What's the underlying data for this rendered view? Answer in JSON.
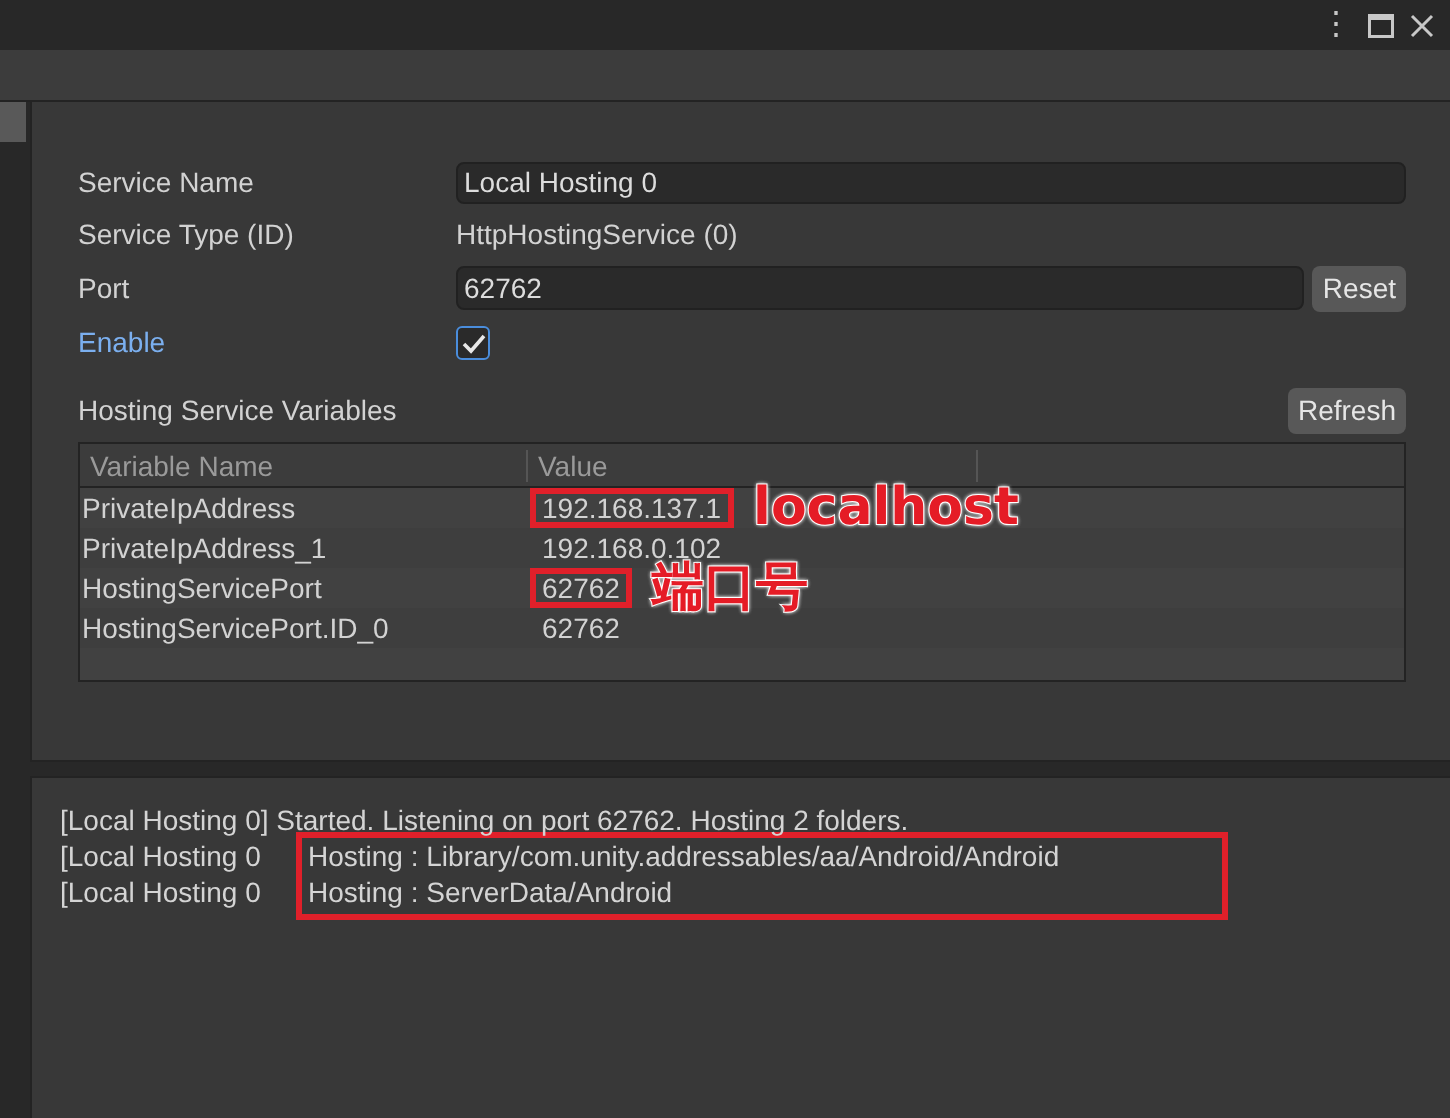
{
  "window_controls": [
    "⋮"
  ],
  "service": {
    "name_label": "Service Name",
    "name_value": "Local Hosting 0",
    "type_label": "Service Type (ID)",
    "type_value": "HttpHostingService (0)",
    "port_label": "Port",
    "port_value": "62762",
    "reset_button": "Reset",
    "enable_label": "Enable",
    "enable_checked": true
  },
  "variables": {
    "title": "Hosting Service Variables",
    "refresh_button": "Refresh",
    "columns": [
      "Variable Name",
      "Value"
    ],
    "rows": [
      {
        "name": "PrivateIpAddress",
        "value": "192.168.137.1",
        "highlighted": true,
        "annotation": "localhost"
      },
      {
        "name": "PrivateIpAddress_1",
        "value": "192.168.0.102",
        "highlighted": false
      },
      {
        "name": "HostingServicePort",
        "value": "62762",
        "highlighted": true,
        "annotation": "端口号"
      },
      {
        "name": "HostingServicePort.ID_0",
        "value": "62762",
        "highlighted": false
      }
    ]
  },
  "log": [
    {
      "prefix": "[Local Hosting 0] Started. Listening on port 62762. Hosting 2 folders.",
      "highlighted": false
    },
    {
      "prefix": "[Local Hosting 0",
      "message": "Hosting : Library/com.unity.addressables/aa/Android/Android",
      "highlighted": true
    },
    {
      "prefix": "[Local Hosting 0",
      "message": "Hosting : ServerData/Android",
      "highlighted": true
    }
  ]
}
